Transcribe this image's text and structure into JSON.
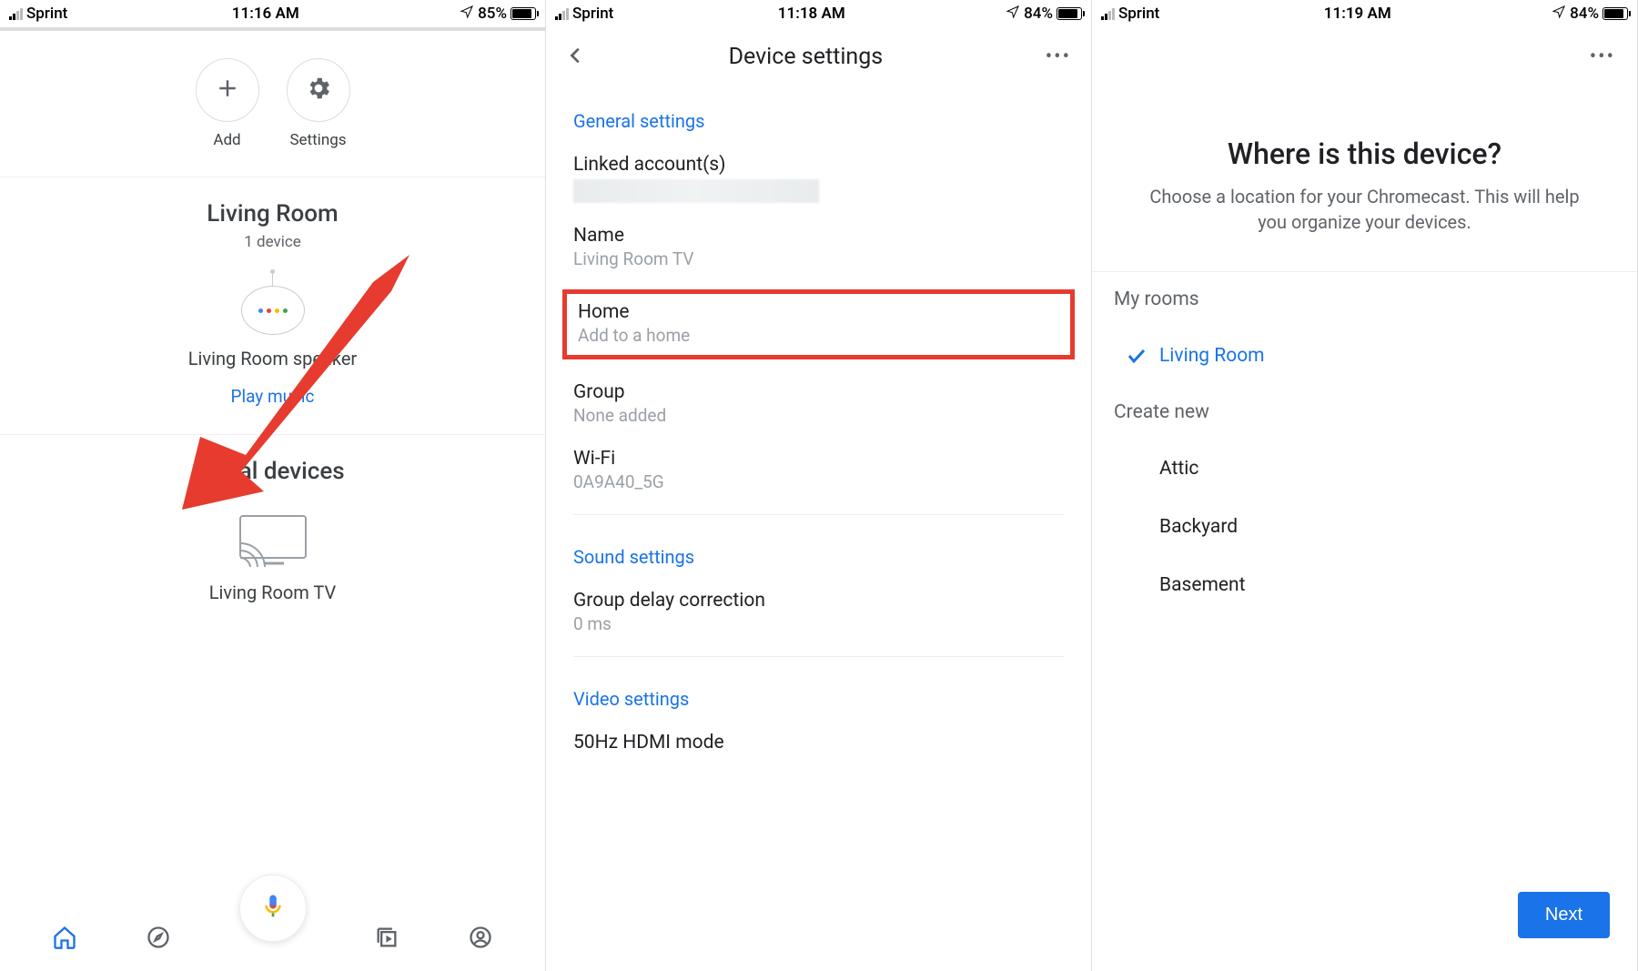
{
  "status": {
    "carrier": "Sprint",
    "pane1_time": "11:16 AM",
    "pane2_time": "11:18 AM",
    "pane3_time": "11:19 AM",
    "pane1_battery": "85%",
    "pane2_battery": "84%",
    "pane3_battery": "84%"
  },
  "pane1": {
    "add_label": "Add",
    "settings_label": "Settings",
    "room_title": "Living Room",
    "room_sub": "1 device",
    "speaker_label": "Living Room speaker",
    "play_music": "Play music",
    "local_title": "Local devices",
    "tv_label": "Living Room TV"
  },
  "pane2": {
    "title": "Device settings",
    "general": "General settings",
    "linked_label": "Linked account(s)",
    "name_label": "Name",
    "name_value": "Living Room TV",
    "home_label": "Home",
    "home_value": "Add to a home",
    "group_label": "Group",
    "group_value": "None added",
    "wifi_label": "Wi-Fi",
    "wifi_value": "0A9A40_5G",
    "sound": "Sound settings",
    "delay_label": "Group delay correction",
    "delay_value": "0 ms",
    "video": "Video settings",
    "hdmi_label": "50Hz HDMI mode"
  },
  "pane3": {
    "heading": "Where is this device?",
    "sub": "Choose a location for your Chromecast. This will help you organize your devices.",
    "myrooms": "My rooms",
    "selected_room": "Living Room",
    "createnew": "Create new",
    "opt1": "Attic",
    "opt2": "Backyard",
    "opt3": "Basement",
    "next": "Next"
  }
}
